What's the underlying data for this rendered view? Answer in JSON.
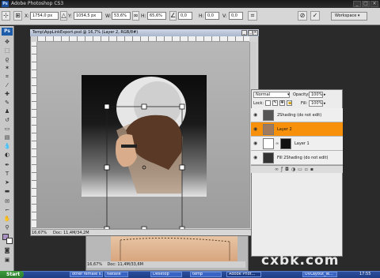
{
  "app": {
    "title": "Adobe Photoshop CS3"
  },
  "options_bar": {
    "x_label": "X:",
    "x_value": "1754,0 px",
    "y_label": "Y:",
    "y_value": "1054,5 px",
    "w_label": "W:",
    "w_value": "53,6%",
    "h_label": "H:",
    "h_value": "65,6%",
    "angle_value": "0,0",
    "h_skew_label": "H:",
    "h_skew_value": "0,0",
    "v_skew_label": "V:",
    "v_skew_value": "0,0",
    "workspace_label": "Workspace"
  },
  "document": {
    "title": "Temp\\AppLinkExport.psd @ 16,7% (Layer 2, RGB/8#)",
    "zoom": "16,67%",
    "doc_size": "Doc: 11,4M/34,2M"
  },
  "back_document": {
    "zoom": "16,67%",
    "doc_size": "Doc: 11,4M/33,6M"
  },
  "layers": {
    "blend_mode": "Normal",
    "opacity_label": "Opacity:",
    "opacity_value": "100%",
    "lock_label": "Lock:",
    "fill_label": "Fill:",
    "fill_value": "100%",
    "items": [
      {
        "name": "2Shading (do not edit)",
        "selected": false
      },
      {
        "name": "Layer 2",
        "selected": true
      },
      {
        "name": "Layer 1",
        "selected": false
      },
      {
        "name": "Fill 2Shading (do not edit)",
        "selected": false
      }
    ]
  },
  "taskbar": {
    "start": "Start",
    "items": [
      "other female s...",
      "Natalie",
      "Desktop",
      "temp",
      "Adobe Phot...",
      "UVLayout_le..."
    ],
    "time": "17:55"
  },
  "watermark": "cxbk.com"
}
